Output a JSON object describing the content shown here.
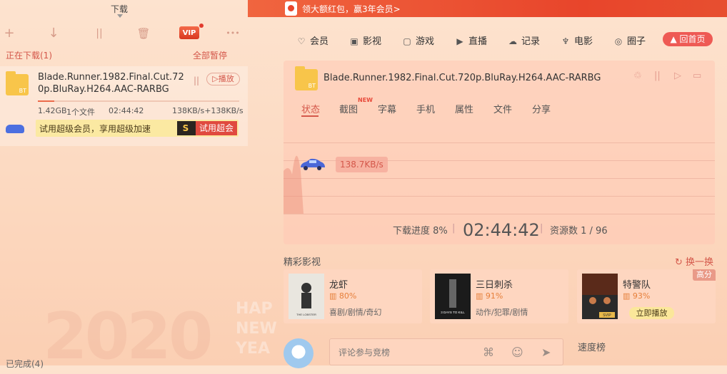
{
  "left": {
    "tab_title": "下载",
    "toolbar": {
      "add_icon": "+",
      "download_icon": "↓",
      "pause_icon": "||",
      "delete_icon": "🗑",
      "vip_label": "VIP",
      "more_icon": "•••"
    },
    "section": {
      "downloading_label": "正在下载(1)",
      "pause_all_label": "全部暂停"
    },
    "task": {
      "icon_label": "BT",
      "file_name": "Blade.Runner.1982.Final.Cut.720p.BluRay.H264.AAC-RARBG",
      "pause_icon": "||",
      "play_label": "▷播放",
      "size": "1.42GB",
      "files": "1个文件",
      "time_left": "02:44:42",
      "speed": "138KB/s+138KB/s",
      "progress_percent": 8
    },
    "promo": {
      "text": "试用超级会员，享用超级加速",
      "s_badge": "S",
      "button_label": "试用超会"
    },
    "completed_label": "已完成(4)",
    "deco_year": "2020",
    "deco_line1": "HAP",
    "deco_line2": "NEW",
    "deco_line3": "YEA"
  },
  "right": {
    "banner_text": "领大额红包，赢3年会员>",
    "nav": [
      {
        "icon": "♡",
        "label": "会员"
      },
      {
        "icon": "▣",
        "label": "影视"
      },
      {
        "icon": "▢",
        "label": "游戏"
      },
      {
        "icon": "▶",
        "label": "直播"
      },
      {
        "icon": "☁",
        "label": "记录"
      },
      {
        "icon": "♆",
        "label": "电影"
      },
      {
        "icon": "◎",
        "label": "圈子"
      }
    ],
    "home_button": "▲ 回首页",
    "detail": {
      "icon_label": "BT",
      "file_name": "Blade.Runner.1982.Final.Cut.720p.BluRay.H264.AAC-RARBG",
      "controls": [
        "♲",
        "||",
        "▷",
        "▭"
      ],
      "tabs": [
        "状态",
        "截图",
        "字幕",
        "手机",
        "属性",
        "文件",
        "分享"
      ],
      "new_tag": "NEW",
      "speed_tag": "138.7KB/s",
      "progress_label": "下载进度 8%",
      "time_left": "02:44:42",
      "resources_label": "资源数 1 / 96"
    },
    "recommend": {
      "title": "精彩影视",
      "refresh_label": "↻ 换一换",
      "hd_tag": "高分",
      "movies": [
        {
          "title": "龙虾",
          "score": "80%",
          "genre": "喜剧/剧情/奇幻",
          "poster_text": "THE LOBSTER"
        },
        {
          "title": "三日刺杀",
          "score": "91%",
          "genre": "动作/犯罪/剧情",
          "poster_text": "3 DAYS TO KILL"
        },
        {
          "title": "特警队",
          "score": "93%",
          "play_label": "立即播放",
          "poster_text": "SVIP"
        }
      ]
    },
    "comment": {
      "placeholder": "评论参与竞榜",
      "rank_title": "速度榜"
    }
  }
}
